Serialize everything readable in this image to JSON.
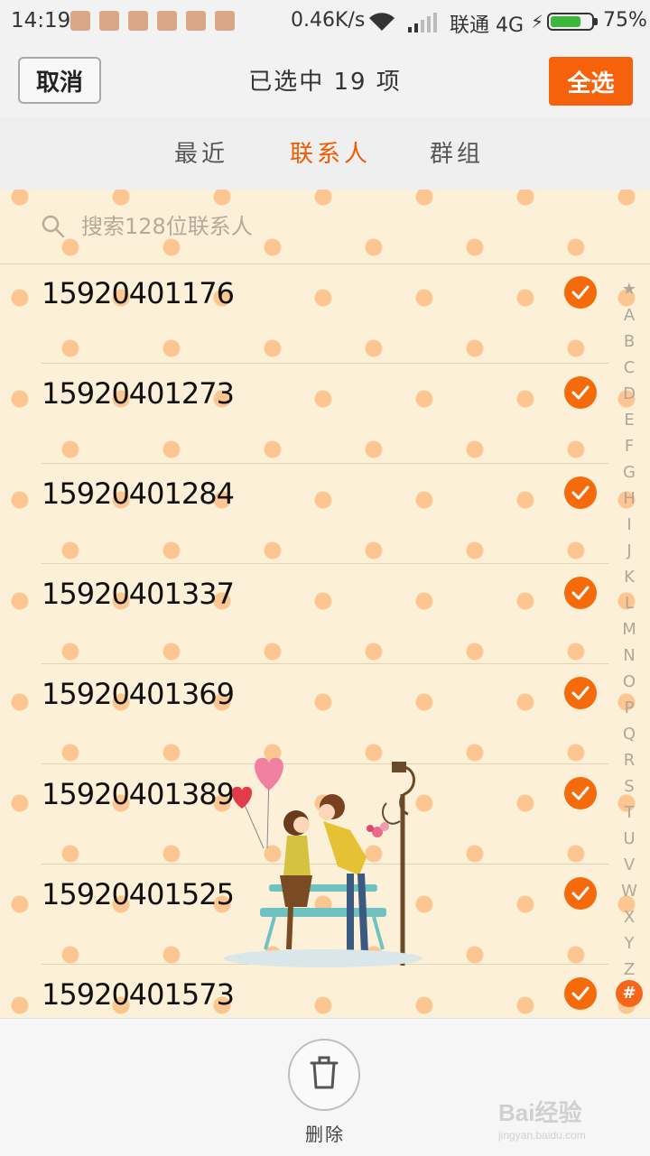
{
  "status_bar": {
    "time": "14:19",
    "net_speed": "0.46K/s",
    "carrier": "联通 4G",
    "battery": "75%",
    "battery_level": 0.75
  },
  "header": {
    "cancel_label": "取消",
    "title": "已选中 19 项",
    "select_all_label": "全选"
  },
  "tabs": [
    {
      "label": "最近",
      "active": false
    },
    {
      "label": "联系人",
      "active": true
    },
    {
      "label": "群组",
      "active": false
    }
  ],
  "search": {
    "placeholder": "搜索128位联系人"
  },
  "contacts": [
    {
      "number": "15920401176",
      "checked": true
    },
    {
      "number": "15920401273",
      "checked": true
    },
    {
      "number": "15920401284",
      "checked": true
    },
    {
      "number": "15920401337",
      "checked": true
    },
    {
      "number": "15920401369",
      "checked": true
    },
    {
      "number": "15920401389",
      "checked": true
    },
    {
      "number": "15920401525",
      "checked": true
    },
    {
      "number": "15920401573",
      "checked": true
    }
  ],
  "alphabet_index": [
    "★",
    "A",
    "B",
    "C",
    "D",
    "E",
    "F",
    "G",
    "H",
    "I",
    "J",
    "K",
    "L",
    "M",
    "N",
    "O",
    "P",
    "Q",
    "R",
    "S",
    "T",
    "U",
    "V",
    "W",
    "X",
    "Y",
    "Z"
  ],
  "alphabet_active": "#",
  "bottom_bar": {
    "delete_label": "删除"
  },
  "watermark": {
    "brand": "Bai经验",
    "url": "jingyan.baidu.com"
  },
  "colors": {
    "accent": "#f6620c",
    "dot": "#fcc690",
    "background": "#fdf0d8"
  }
}
